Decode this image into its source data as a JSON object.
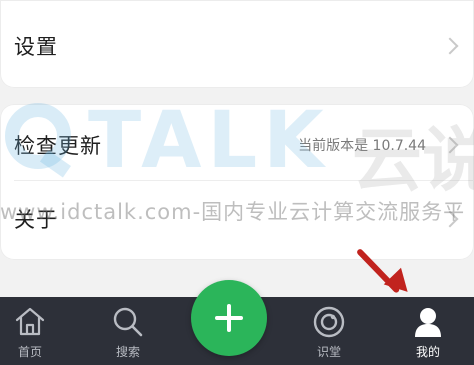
{
  "settings_section": {
    "label": "设置"
  },
  "about_section": {
    "check_update_label": "检查更新",
    "current_version_text": "当前版本是 10.7.44",
    "about_label": "关于"
  },
  "watermark": {
    "logo_letters": "TALK",
    "logo_cn": "云说",
    "line": "www.idctalk.com-国内专业云计算交流服务平"
  },
  "tabbar": {
    "items": [
      {
        "label": "首页",
        "icon": "home-icon"
      },
      {
        "label": "搜索",
        "icon": "search-icon"
      },
      {
        "label": "识堂",
        "icon": "focus-circle-icon"
      },
      {
        "label": "我的",
        "icon": "person-icon",
        "active": true
      }
    ],
    "fab_icon": "plus-icon",
    "background": "#2d3039",
    "fab_color": "#2bb55a"
  },
  "annotation_color": "#c1231e"
}
